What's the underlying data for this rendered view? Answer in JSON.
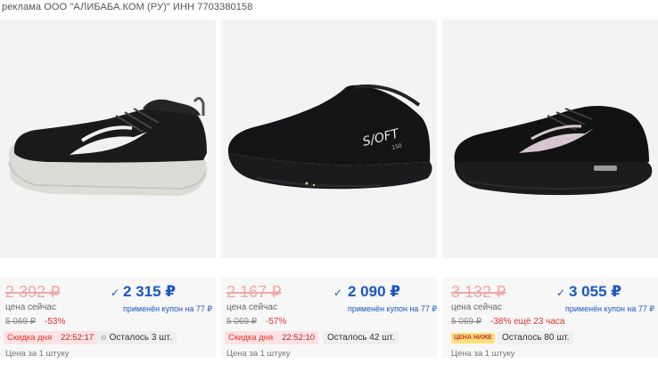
{
  "ad_label": "реклама ООО \"АЛИБАБА.КОМ (РУ)\" ИНН 7703380158",
  "colors": {
    "price_blue": "#1a56c4",
    "discount_red": "#e0322c",
    "old_price_pink": "#f2a7a7"
  },
  "products": [
    {
      "old_price": "2 392 ₽",
      "now_label": "цена сейчас",
      "price": "2 315 ₽",
      "coupon": "применён купон на 77 ₽",
      "base_price": "5 069 ₽",
      "discount": "-53%",
      "deal_label": "Скидка дня",
      "timer": "22:52:17",
      "stock": "Осталось 3 шт.",
      "per_unit": "Цена за 1 штуку"
    },
    {
      "old_price": "2 167 ₽",
      "now_label": "цена сейчас",
      "price": "2 090 ₽",
      "coupon": "применён купон на 77 ₽",
      "base_price": "5 069 ₽",
      "discount": "-57%",
      "deal_label": "Скидка дня",
      "timer": "22:52:10",
      "stock": "Осталось 42 шт.",
      "per_unit": "Цена за 1 штуку"
    },
    {
      "old_price": "3 132 ₽",
      "now_label": "цена сейчас",
      "price": "3 055 ₽",
      "coupon": "применён купон на 77 ₽",
      "base_price": "5 069 ₽",
      "discount": "-38% ещё 23 часа",
      "lower_badge": "ЦЕНА НИЖЕ",
      "stock": "Осталось 80 шт.",
      "per_unit": "Цена за 1 штуку"
    }
  ]
}
